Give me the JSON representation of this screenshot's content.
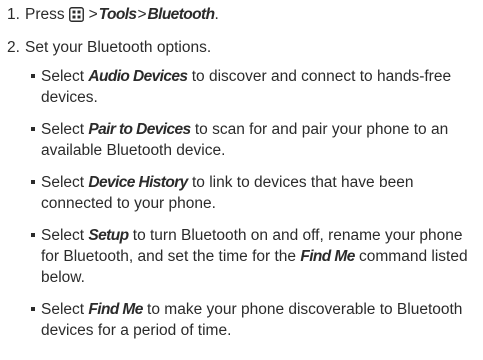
{
  "steps": [
    {
      "number": "1.",
      "text_before": "Press",
      "icon": "menu-key-icon",
      "sep1": ">",
      "menu1": "Tools",
      "sep2": ">",
      "menu2": "Bluetooth",
      "end": "."
    },
    {
      "number": "2.",
      "text": "Set your Bluetooth options."
    }
  ],
  "bullets": [
    {
      "pre": "Select ",
      "term": "Audio Devices",
      "rest": " to discover and connect to hands-free devices."
    },
    {
      "pre": "Select ",
      "term": "Pair to Devices",
      "rest": " to scan for and pair your phone to an available Bluetooth device."
    },
    {
      "pre": "Select ",
      "term": "Device History",
      "rest": " to link to devices that have been connected to your phone."
    },
    {
      "pre": "Select ",
      "term": "Setup",
      "rest": " to turn Bluetooth on and off, rename your phone for Bluetooth, and set the time for the ",
      "term2": "Find Me",
      "rest2": " command listed below."
    },
    {
      "pre": "Select ",
      "term": "Find Me",
      "rest": " to make your phone discoverable to Bluetooth devices for a period of time."
    }
  ]
}
